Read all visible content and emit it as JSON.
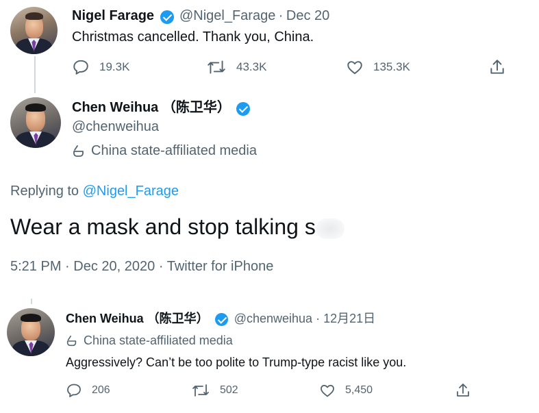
{
  "tweet1": {
    "name": "Nigel Farage",
    "handle": "@Nigel_Farage",
    "sep": "·",
    "date": "Dec 20",
    "text": "Christmas cancelled. Thank you, China.",
    "replies": "19.3K",
    "retweets": "43.3K",
    "likes": "135.3K"
  },
  "tweet2": {
    "name": "Chen Weihua （陈卫华）",
    "handle": "@chenweihua",
    "label": "China state-affiliated media",
    "replying_prefix": "Replying to",
    "replying_handle": "@Nigel_Farage",
    "text": "Wear a mask and stop talking s",
    "time": "5:21 PM",
    "date": "Dec 20, 2020",
    "source": "Twitter for iPhone",
    "sep": "·"
  },
  "tweet3": {
    "name": "Chen Weihua （陈卫华）",
    "handle": "@chenweihua",
    "sep": "·",
    "date": "12月21日",
    "label": "China state-affiliated media",
    "text": "Aggressively? Can’t be too polite to Trump-type racist like you.",
    "replies": "206",
    "retweets": "502",
    "likes": "5,450"
  },
  "colors": {
    "verified": "#1d9bf0",
    "link": "#1d9bf0",
    "secondary_text": "#536471",
    "thread_line": "#cfd9de"
  },
  "icons": [
    "reply-icon",
    "retweet-icon",
    "like-icon",
    "share-icon",
    "verified-icon",
    "state-media-icon"
  ]
}
